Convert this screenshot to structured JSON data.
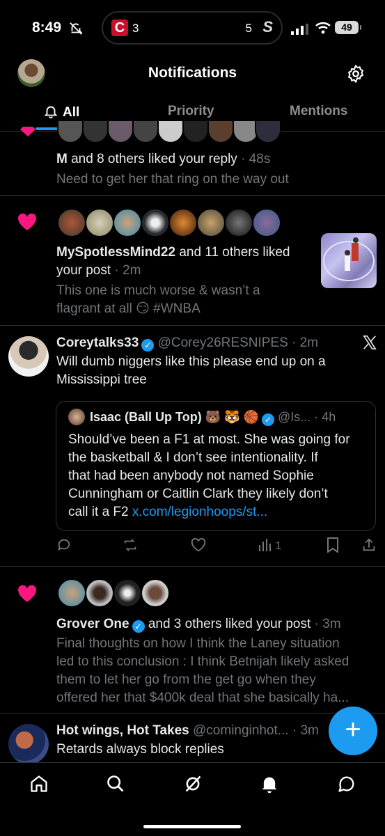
{
  "status_bar": {
    "time": "8:49",
    "live_activity": {
      "left_score": "3",
      "right_score": "5",
      "left_logo": "C",
      "right_logo": "S"
    },
    "battery": "49"
  },
  "header": {
    "title": "Notifications"
  },
  "tabs": [
    {
      "label": "All",
      "active": true
    },
    {
      "label": "Priority",
      "active": false
    },
    {
      "label": "Mentions",
      "active": false
    }
  ],
  "notif1": {
    "name": "M",
    "action": " and 8 others liked your reply",
    "time": " · 48s",
    "snippet": "Need to get her that ring on the way out"
  },
  "notif2": {
    "name": "MySpotlessMind22",
    "action": " and 11 others liked",
    "action2": "your post",
    "time": " · 2m",
    "snippet_line1": "This one is much worse & wasn’t a",
    "snippet_line2": "flagrant at all",
    "emoji": "😏",
    "hashtag": "#WNBA"
  },
  "post": {
    "author": "Coreytalks33",
    "handle": "@Corey26RESNIPES",
    "time": " · 2m",
    "line1": "Will dumb niggers like this please end up on a",
    "line2": "Mississippi tree",
    "quote": {
      "author": "Isaac (Ball Up Top)",
      "emojis": "🐻 🐯 🏀",
      "handle": "@Is...",
      "time": " · 4h",
      "line1": "Should’ve been a F1 at most. She was going for",
      "line2": "the basketball & I don’t see intentionality. If",
      "line3": "that had been anybody not named Sophie",
      "line4": "Cunningham or Caitlin Clark they likely don’t",
      "line5_prefix": "call it a F2 ",
      "link": "x.com/legionhoops/st..."
    },
    "views": "1"
  },
  "notif3": {
    "name": "Grover One",
    "action": " and 3 others liked your post",
    "time": " · 3m",
    "line1": "Final thoughts on how I think the Laney situation",
    "line2": "led to this conclusion : I think Betnijah likely asked",
    "line3": "them to let her go from the get go when they",
    "line4": "offered her that $400k deal that she basically ha..."
  },
  "notif4": {
    "name": "Hot wings, Hot Takes",
    "handle": "@cominginhot...",
    "time": " · 3m",
    "line1": "Retards always block replies"
  },
  "colors": {
    "accent": "#1d9bf0",
    "like": "#f91880",
    "background": "#000000"
  }
}
